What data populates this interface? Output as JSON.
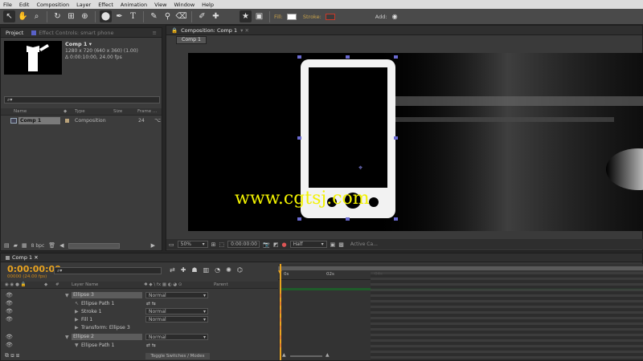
{
  "menu": [
    "File",
    "Edit",
    "Composition",
    "Layer",
    "Effect",
    "Animation",
    "View",
    "Window",
    "Help"
  ],
  "toolbar": {
    "fill_label": "Fill:",
    "stroke_label": "Stroke:",
    "add_label": "Add:",
    "fill_color": "#ffffff",
    "stroke_color": "#c63a2a"
  },
  "project": {
    "tab_project": "Project",
    "tab_effects": "Effect Controls: smart phone",
    "comp_name": "Comp 1 ▾",
    "comp_dims": "1280 x 720  (640 x 360) (1.00)",
    "comp_duration": "Δ 0:00:10:00, 24.00 fps",
    "search_placeholder": "⌕▾",
    "columns": [
      "Name",
      "Type",
      "Size",
      "Frame ..."
    ],
    "items": [
      {
        "name": "Comp 1",
        "type": "Composition",
        "frame": "24"
      }
    ],
    "bpc": "8 bpc"
  },
  "composition": {
    "tab": "Composition: Comp 1",
    "subtab": "Comp 1",
    "watermark": "www.cgtsj.com",
    "zoom": "50%",
    "timecode": "0:00:00:00",
    "resolution": "Half",
    "active_camera": "Active Ca..."
  },
  "timeline": {
    "tab": "Comp 1",
    "timecode": "0:00:00:00",
    "frames": "00000 (24.00 fps)",
    "col_layer": "Layer Name",
    "col_parent": "Parent",
    "ruler": [
      "0s",
      "02s",
      "04s"
    ],
    "rows": [
      {
        "label": "Ellipse 3",
        "mode": "Normal"
      },
      {
        "label": "Ellipse Path 1"
      },
      {
        "label": "Stroke 1",
        "mode": "Normal"
      },
      {
        "label": "Fill 1",
        "mode": "Normal"
      },
      {
        "label": "Transform: Ellipse 3"
      },
      {
        "label": "Ellipse 2",
        "mode": "Normal"
      },
      {
        "label": "Ellipse Path 1"
      }
    ],
    "toggle": "Toggle Switches / Modes"
  }
}
